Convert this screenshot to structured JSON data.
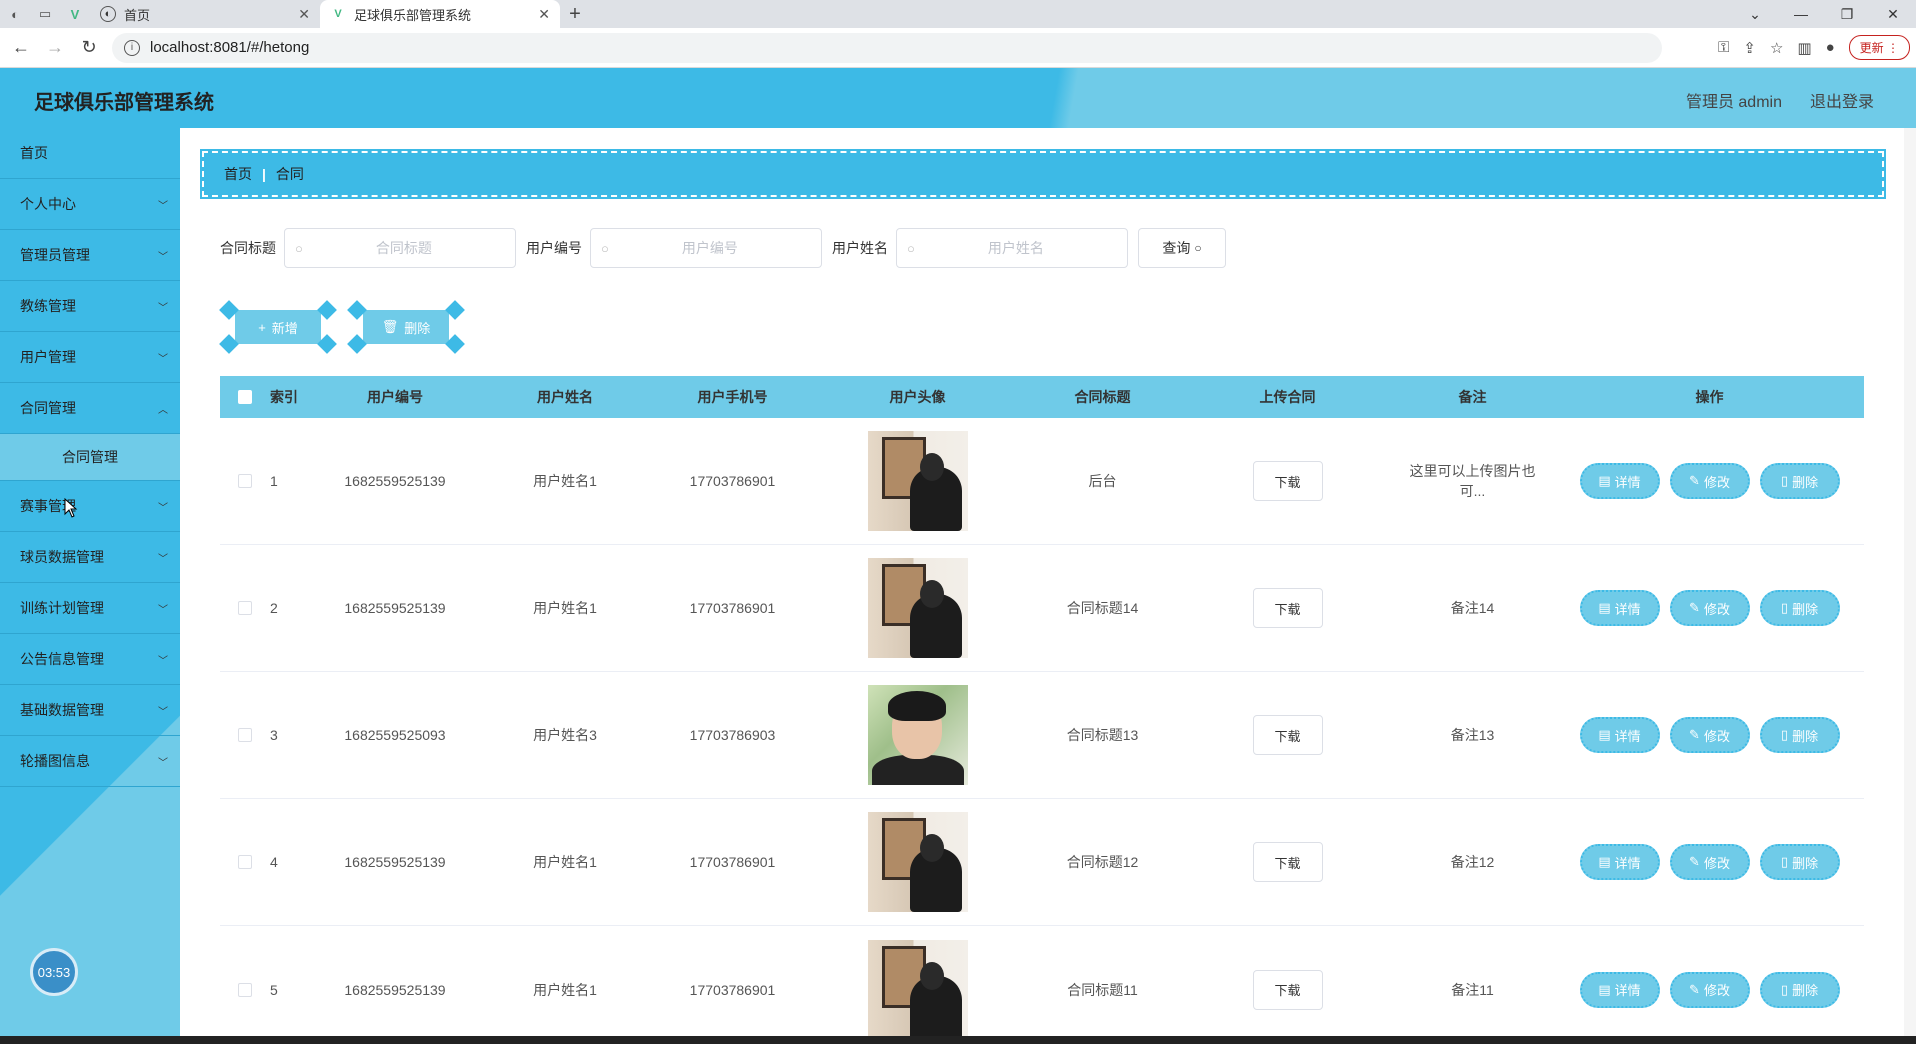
{
  "browser": {
    "tabs": [
      {
        "title": "首页",
        "active": false
      },
      {
        "title": "足球俱乐部管理系统",
        "active": true
      }
    ],
    "url": "localhost:8081/#/hetong",
    "update_label": "更新"
  },
  "header": {
    "title": "足球俱乐部管理系统",
    "user": "管理员 admin",
    "logout": "退出登录"
  },
  "sidebar": {
    "items": [
      {
        "label": "首页"
      },
      {
        "label": "个人中心"
      },
      {
        "label": "管理员管理"
      },
      {
        "label": "教练管理"
      },
      {
        "label": "用户管理"
      },
      {
        "label": "合同管理"
      },
      {
        "label": "赛事管理"
      },
      {
        "label": "球员数据管理"
      },
      {
        "label": "训练计划管理"
      },
      {
        "label": "公告信息管理"
      },
      {
        "label": "基础数据管理"
      },
      {
        "label": "轮播图信息"
      }
    ],
    "sub_item": "合同管理",
    "clock": "03:53"
  },
  "breadcrumb": {
    "home": "首页",
    "current": "合同"
  },
  "search": {
    "title_label": "合同标题",
    "title_placeholder": "合同标题",
    "uid_label": "用户编号",
    "uid_placeholder": "用户编号",
    "name_label": "用户姓名",
    "name_placeholder": "用户姓名",
    "query_label": "查询"
  },
  "actions": {
    "add": "新增",
    "delete": "删除"
  },
  "table": {
    "headers": {
      "index": "索引",
      "uid": "用户编号",
      "name": "用户姓名",
      "phone": "用户手机号",
      "avatar": "用户头像",
      "title": "合同标题",
      "upload": "上传合同",
      "note": "备注",
      "ops": "操作"
    },
    "download_label": "下载",
    "op_labels": {
      "detail": "详情",
      "edit": "修改",
      "delete": "删除"
    },
    "rows": [
      {
        "index": "1",
        "uid": "1682559525139",
        "name": "用户姓名1",
        "phone": "17703786901",
        "title": "后台",
        "note": "这里可以上传图片也可..."
      },
      {
        "index": "2",
        "uid": "1682559525139",
        "name": "用户姓名1",
        "phone": "17703786901",
        "title": "合同标题14",
        "note": "备注14"
      },
      {
        "index": "3",
        "uid": "1682559525093",
        "name": "用户姓名3",
        "phone": "17703786903",
        "title": "合同标题13",
        "note": "备注13"
      },
      {
        "index": "4",
        "uid": "1682559525139",
        "name": "用户姓名1",
        "phone": "17703786901",
        "title": "合同标题12",
        "note": "备注12"
      },
      {
        "index": "5",
        "uid": "1682559525139",
        "name": "用户姓名1",
        "phone": "17703786901",
        "title": "合同标题11",
        "note": "备注11"
      }
    ]
  },
  "colors": {
    "primary": "#3dbae6",
    "light": "#6fcbe8"
  }
}
